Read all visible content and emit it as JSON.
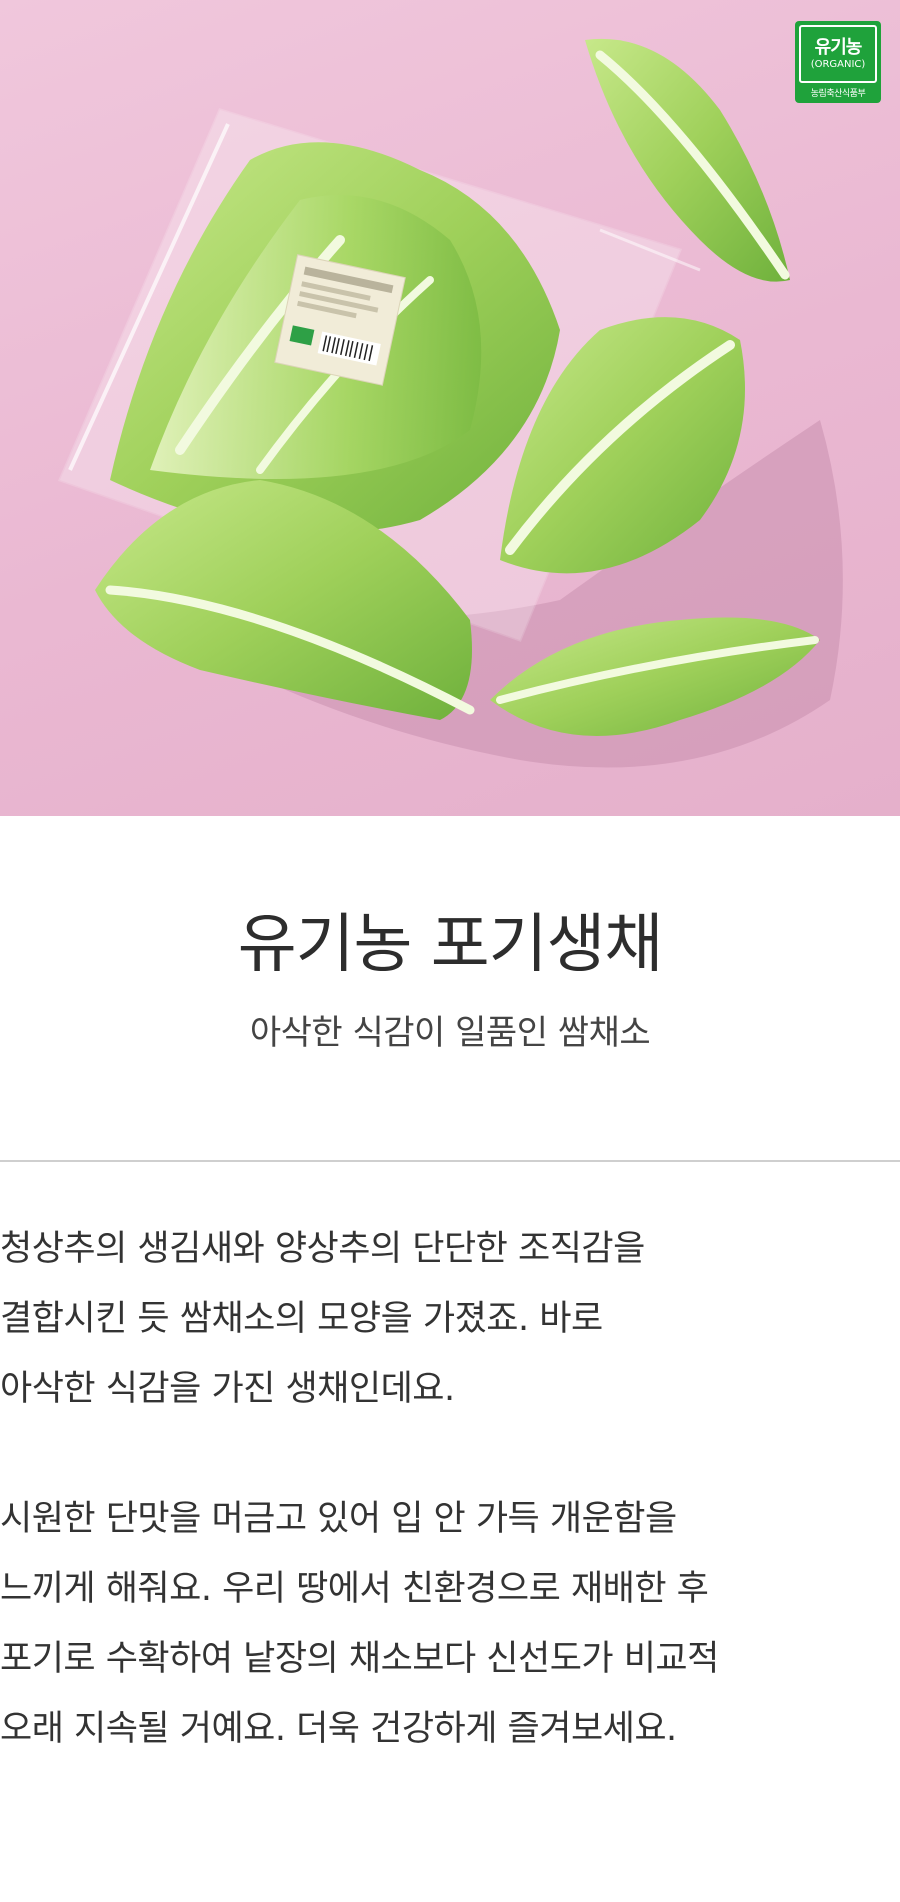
{
  "hero": {
    "image_description": "photo-of-lettuce",
    "badge": {
      "title": "유기농",
      "sub": "(ORGANIC)",
      "foot": "농림축산식품부"
    },
    "label": {
      "title": "친환경채소(유기농)"
    }
  },
  "product": {
    "title": "유기농 포기생채",
    "subtitle": "아삭한 식감이 일품인 쌈채소"
  },
  "description": {
    "paragraph1": [
      "청상추의 생김새와 양상추의 단단한 조직감을",
      "결합시킨 듯 쌈채소의 모양을 가졌죠. 바로",
      "아삭한 식감을 가진 생채인데요."
    ],
    "paragraph2": [
      "시원한 단맛을 머금고 있어 입 안 가득 개운함을",
      "느끼게 해줘요. 우리 땅에서 친환경으로 재배한 후",
      "포기로 수확하여 낱장의 채소보다 신선도가 비교적",
      "오래 지속될 거예요. 더욱 건강하게 즐겨보세요."
    ]
  },
  "colors": {
    "background_pink": "#ecbdd6",
    "lettuce_green": "#9ccf5a",
    "organic_badge_green": "#1fa23b",
    "divider": "#cfcfcf"
  }
}
